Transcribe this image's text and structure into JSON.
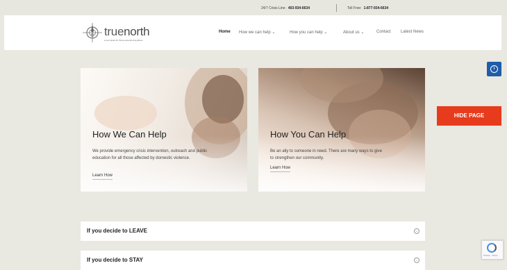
{
  "topbar": {
    "crisis_label": "24/7 Crisis Line:",
    "crisis_number": "403-934-6634",
    "tollfree_label": "Toll Free:",
    "tollfree_number": "1-877-934-6634"
  },
  "header": {
    "logo_prefix": "true",
    "logo_suffix": "north",
    "logo_tagline": "a new place for those experiencing abuse",
    "logo_icon": "compass-icon",
    "nav": [
      {
        "label": "Home",
        "active": true
      },
      {
        "label": "How we can help",
        "dropdown": true
      },
      {
        "label": "How you can help",
        "dropdown": true
      },
      {
        "label": "About us",
        "dropdown": true
      },
      {
        "label": "Contact"
      },
      {
        "label": "Latest News"
      }
    ],
    "dropdown_glyph": "⌄"
  },
  "cards": [
    {
      "title": "How We Can Help",
      "text": "We provide emergency crisis intervention, outreach and public education for all those affected by domestic violence.",
      "link": "Learn How"
    },
    {
      "title": "How You Can Help",
      "text": "Be an ally to someone in need. There are many ways to give to strengthen our community.",
      "link": "Learn How"
    }
  ],
  "accordion": [
    {
      "label": "If you decide to LEAVE",
      "icon": "chevron-circle-icon"
    },
    {
      "label": "If you decide to STAY",
      "icon": "chevron-circle-icon"
    }
  ],
  "floating": {
    "hide_page_label": "HIDE PAGE",
    "accessibility_icon": "accessibility-icon",
    "recaptcha_icon": "recaptcha-icon",
    "recaptcha_text": "Privacy - Terms",
    "hide_page_color": "#e63b1c",
    "accessibility_color": "#1f5ca9"
  }
}
